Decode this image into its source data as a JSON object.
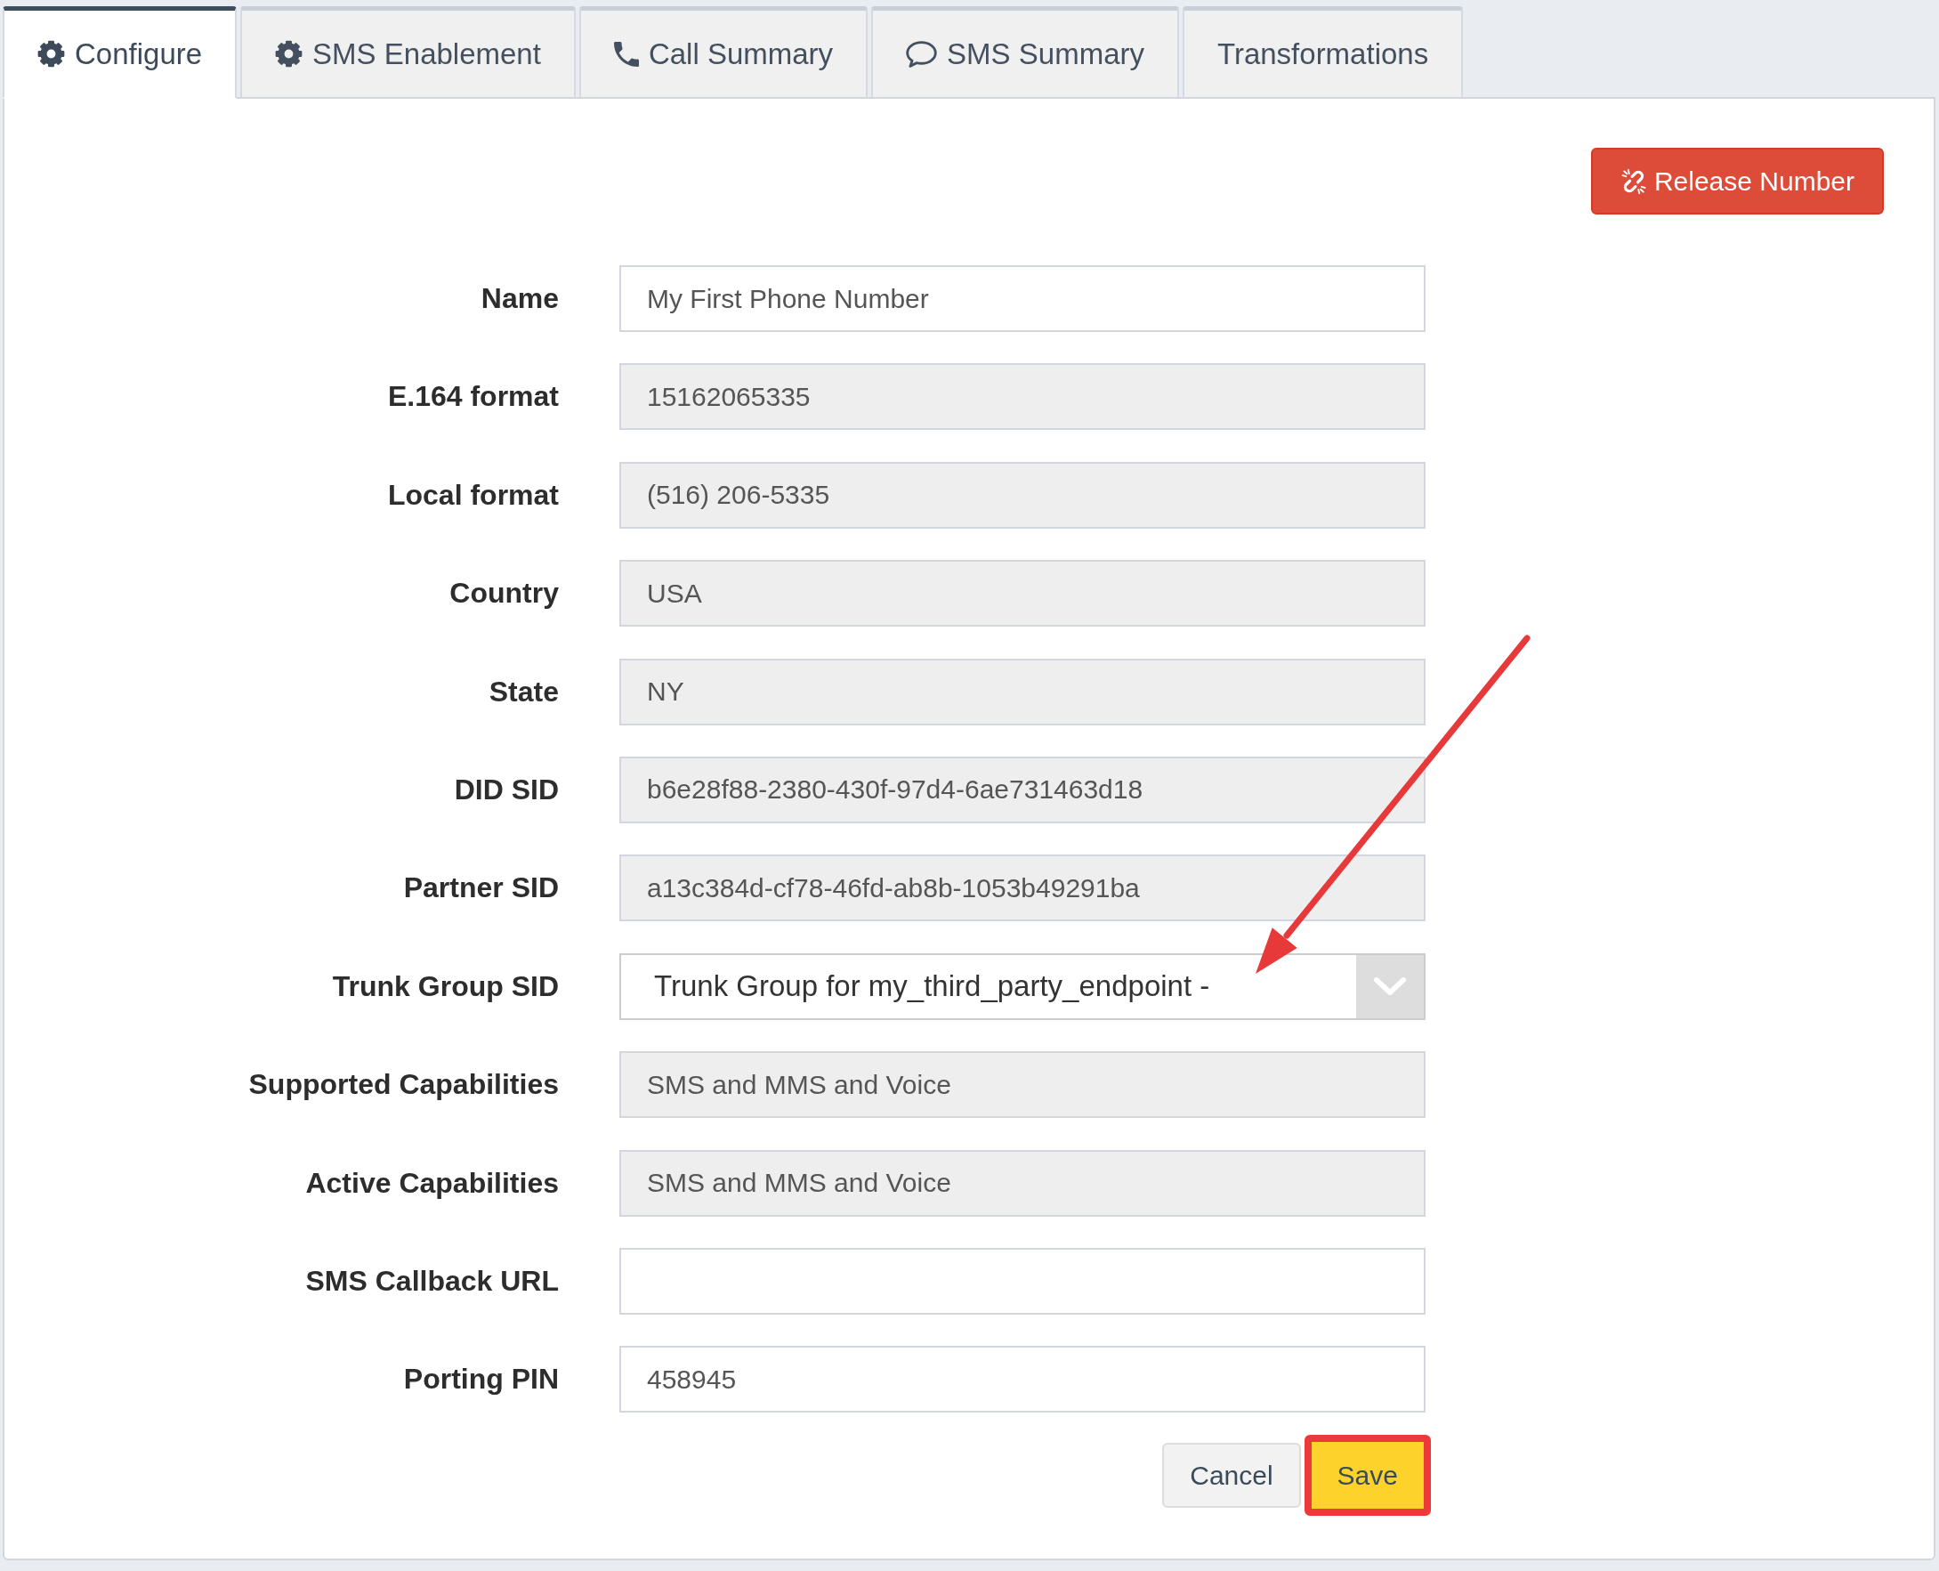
{
  "tabs": [
    {
      "label": "Configure",
      "kind": "gear",
      "selected": true
    },
    {
      "label": "SMS Enablement",
      "kind": "gear",
      "selected": false
    },
    {
      "label": "Call Summary",
      "kind": "phone",
      "selected": false
    },
    {
      "label": "SMS Summary",
      "kind": "chat",
      "selected": false
    },
    {
      "label": "Transformations",
      "kind": "plain",
      "selected": false
    }
  ],
  "release_button": {
    "label": "Release Number"
  },
  "fields": [
    {
      "label": "Name",
      "kind": "input",
      "value": "My First Phone Number",
      "readonly": false
    },
    {
      "label": "E.164 format",
      "kind": "input",
      "value": "15162065335",
      "readonly": true
    },
    {
      "label": "Local format",
      "kind": "input",
      "value": "(516) 206-5335",
      "readonly": true
    },
    {
      "label": "Country",
      "kind": "input",
      "value": "USA",
      "readonly": true
    },
    {
      "label": "State",
      "kind": "input",
      "value": "NY",
      "readonly": true
    },
    {
      "label": "DID SID",
      "kind": "input",
      "value": "b6e28f88-2380-430f-97d4-6ae731463d18",
      "readonly": true
    },
    {
      "label": "Partner SID",
      "kind": "input",
      "value": "a13c384d-cf78-46fd-ab8b-1053b49291ba",
      "readonly": true
    },
    {
      "label": "Trunk Group SID",
      "kind": "select",
      "value": "Trunk Group for my_third_party_endpoint -",
      "readonly": false
    },
    {
      "label": "Supported Capabilities",
      "kind": "input",
      "value": "SMS and MMS and Voice",
      "readonly": true
    },
    {
      "label": "Active Capabilities",
      "kind": "input",
      "value": "SMS and MMS and Voice",
      "readonly": true
    },
    {
      "label": "SMS Callback URL",
      "kind": "input",
      "readonly": false
    },
    {
      "label": "Porting PIN",
      "kind": "input",
      "value": "458945",
      "readonly": false
    }
  ],
  "buttons": [
    {
      "label": "Cancel",
      "kind": "default",
      "highlighted": false
    },
    {
      "label": "Save",
      "kind": "primary",
      "highlighted": true
    }
  ],
  "annotations": [
    {
      "kind": "arrow"
    }
  ]
}
